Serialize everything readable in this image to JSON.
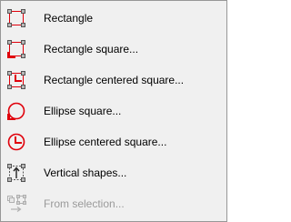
{
  "menu": {
    "items": [
      {
        "label": "Rectangle",
        "icon": "rectangle-icon",
        "enabled": true
      },
      {
        "label": "Rectangle square...",
        "icon": "rectangle-square-icon",
        "enabled": true
      },
      {
        "label": "Rectangle centered square...",
        "icon": "rectangle-centered-square-icon",
        "enabled": true
      },
      {
        "label": "Ellipse square...",
        "icon": "ellipse-square-icon",
        "enabled": true
      },
      {
        "label": "Ellipse centered square...",
        "icon": "ellipse-centered-square-icon",
        "enabled": true
      },
      {
        "label": "Vertical shapes...",
        "icon": "vertical-shapes-icon",
        "enabled": true
      },
      {
        "label": "From selection...",
        "icon": "from-selection-icon",
        "enabled": false
      }
    ]
  },
  "colors": {
    "menu_background": "#f0f0f0",
    "menu_border": "#979797",
    "icon_red": "#e0000b",
    "handle_fill": "#b8b8b8",
    "disabled_text": "#9a9a9a"
  }
}
